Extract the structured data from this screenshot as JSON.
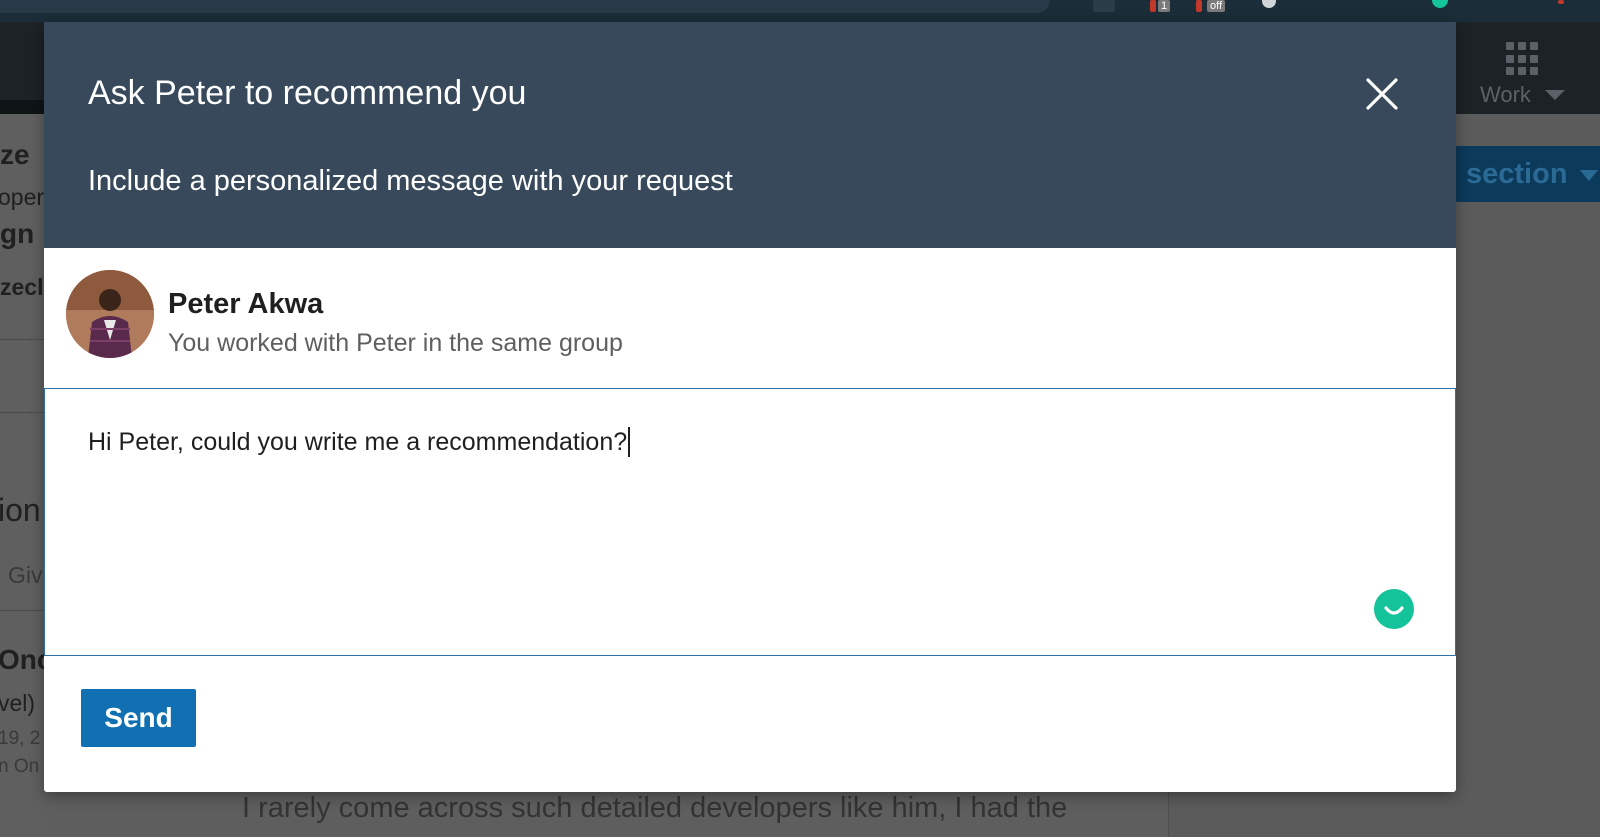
{
  "browser": {
    "badge_one": "1",
    "badge_off": "off"
  },
  "background": {
    "left_snippets": [
      "ze",
      "oper",
      "gn ·",
      "zecl",
      "ion",
      "Giv",
      "Onc",
      "vel)",
      "19, 2",
      "n On"
    ],
    "nav_work_label": "Work",
    "section_label": "section",
    "bottom_text": "I rarely come across such detailed developers like him, I had the"
  },
  "modal": {
    "title": "Ask Peter to recommend you",
    "subtitle": "Include a personalized message with your request",
    "recipient": {
      "name": "Peter Akwa",
      "context": "You worked with Peter in the same group"
    },
    "message": {
      "value": "Hi Peter, could you write me a recommendation?"
    },
    "send_label": "Send"
  },
  "icons": {
    "close": "close-icon",
    "grammarly": "grammarly-icon"
  },
  "colors": {
    "header_bg": "#37495a",
    "primary_button": "#1170b2",
    "input_border": "#2f6fa8",
    "grammarly_green": "#15c39a"
  }
}
